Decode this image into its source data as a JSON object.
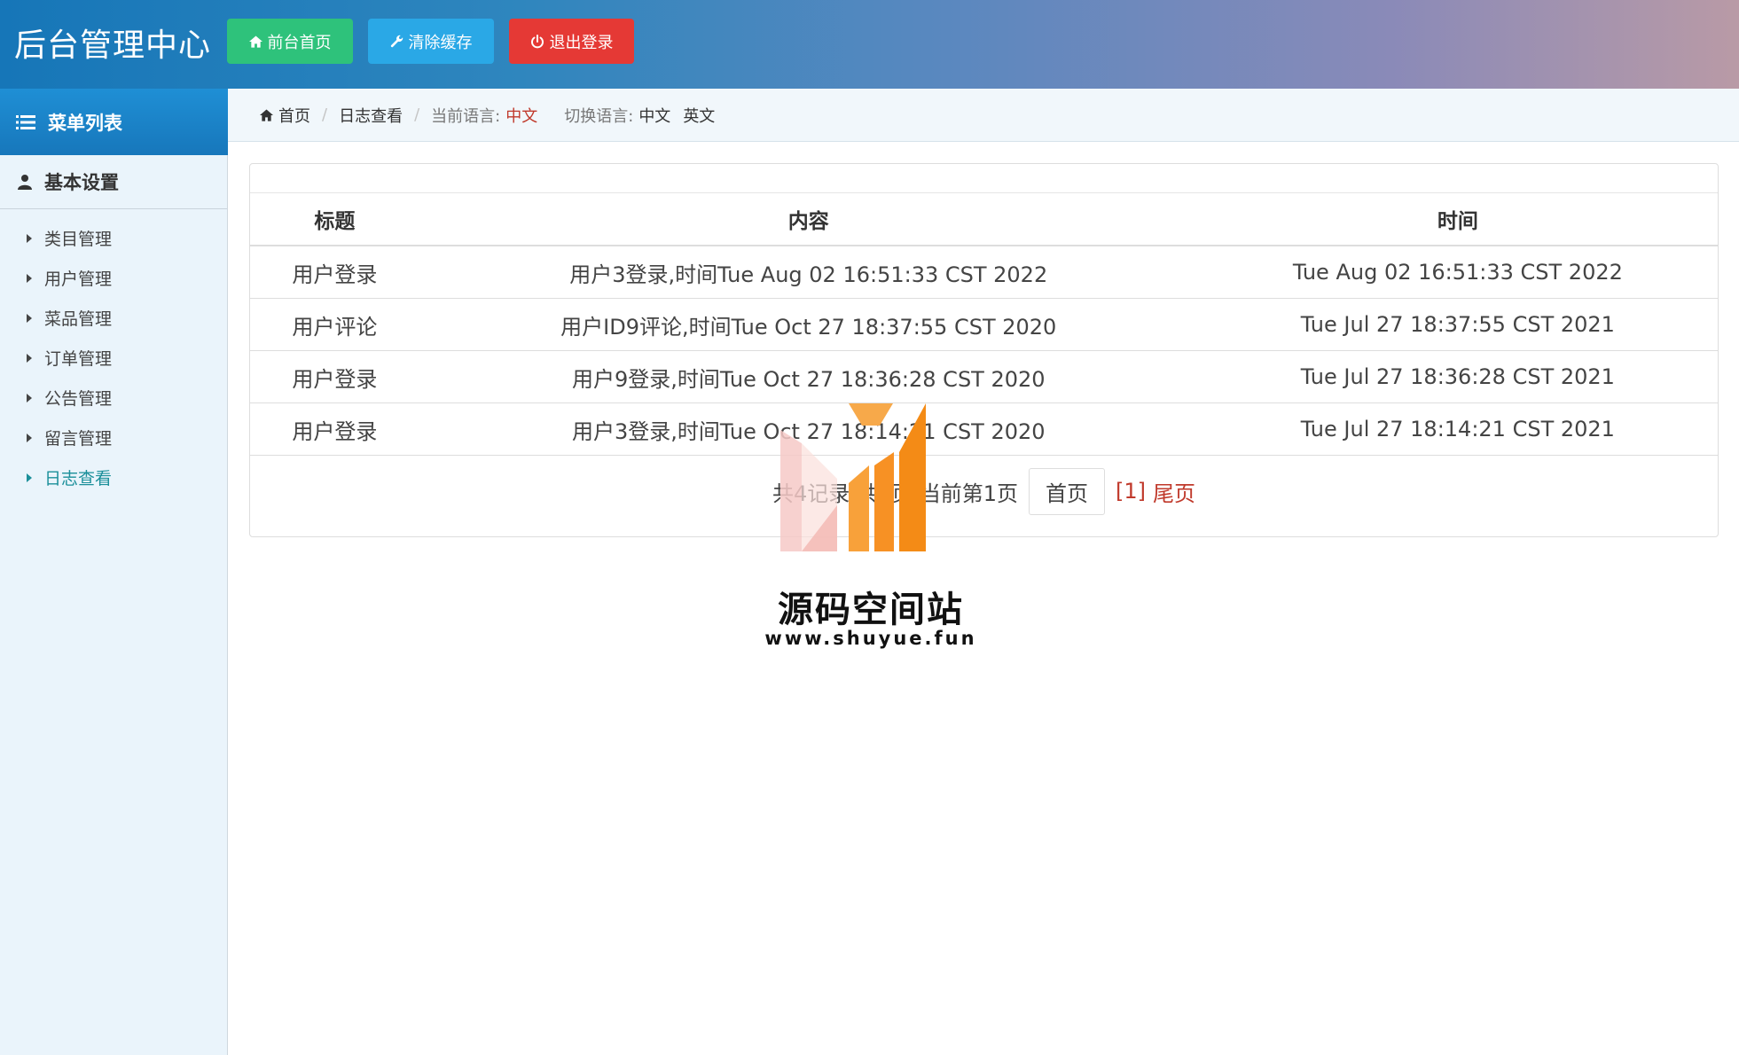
{
  "header": {
    "brand": "后台管理中心",
    "buttons": {
      "front": "前台首页",
      "cache": "清除缓存",
      "logout": "退出登录"
    }
  },
  "sidebar": {
    "menu_title": "菜单列表",
    "group_title": "基本设置",
    "items": [
      "类目管理",
      "用户管理",
      "菜品管理",
      "订单管理",
      "公告管理",
      "留言管理",
      "日志查看"
    ],
    "active_index": 6
  },
  "breadcrumb": {
    "home": "首页",
    "current": "日志查看",
    "lang_label": "当前语言:",
    "lang_value": "中文",
    "switch_label": "切换语言:",
    "lang_options": [
      "中文",
      "英文"
    ]
  },
  "table": {
    "headers": [
      "标题",
      "内容",
      "时间"
    ],
    "rows": [
      [
        "用户登录",
        "用户3登录,时间Tue Aug 02 16:51:33 CST 2022",
        "Tue Aug 02 16:51:33 CST 2022"
      ],
      [
        "用户评论",
        "用户ID9评论,时间Tue Oct 27 18:37:55 CST 2020",
        "Tue Jul 27 18:37:55 CST 2021"
      ],
      [
        "用户登录",
        "用户9登录,时间Tue Oct 27 18:36:28 CST 2020",
        "Tue Jul 27 18:36:28 CST 2021"
      ],
      [
        "用户登录",
        "用户3登录,时间Tue Oct 27 18:14:21 CST 2020",
        "Tue Jul 27 18:14:21 CST 2021"
      ]
    ]
  },
  "pager": {
    "summary": "共4记录,共1页,当前第1页",
    "first": "首页",
    "current": "[1]",
    "last": "尾页"
  },
  "watermark": {
    "title": "源码空间站",
    "url": "www.shuyue.fun"
  },
  "colors": {
    "green": "#2ec27b",
    "blue": "#2aa8e6",
    "red": "#e53935",
    "accent_link": "#c0392b",
    "active_menu": "#1b8f9a"
  }
}
